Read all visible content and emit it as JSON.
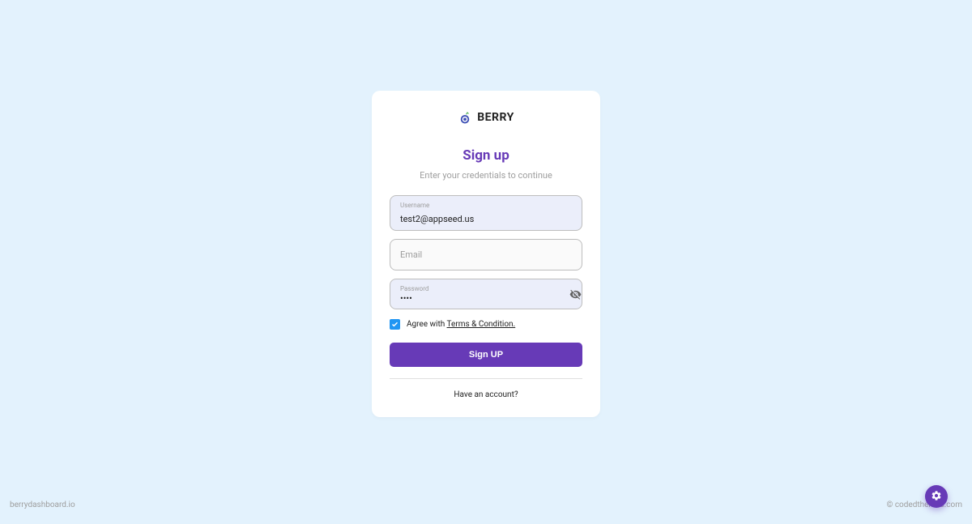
{
  "logo": {
    "text": "BERRY"
  },
  "title": "Sign up",
  "subtitle": "Enter your credentials to continue",
  "form": {
    "username": {
      "label": "Username",
      "value": "test2@appseed.us"
    },
    "email": {
      "placeholder": "Email",
      "value": ""
    },
    "password": {
      "label": "Password",
      "value": "••••"
    }
  },
  "agree": {
    "checked": true,
    "prefix": "Agree with  ",
    "terms_label": "Terms & Condition."
  },
  "signup_button_label": "Sign UP",
  "have_account": "Have an account?",
  "footer": {
    "left": "berrydashboard.io",
    "right": "© codedthemes.com"
  }
}
